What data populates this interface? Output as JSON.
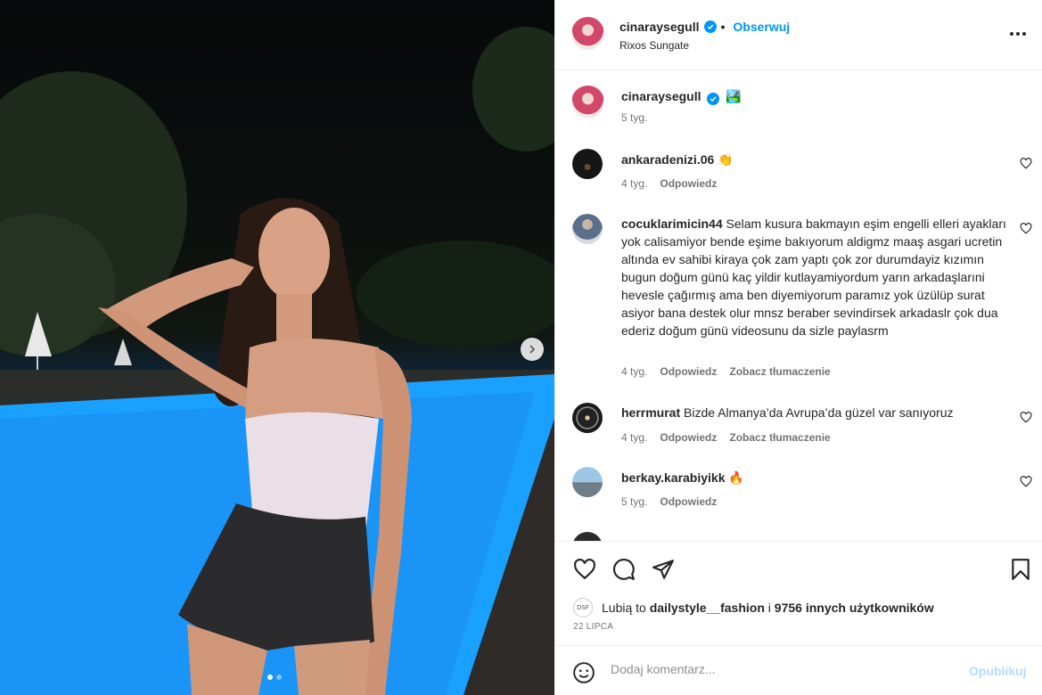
{
  "post": {
    "username": "cinaraysegull",
    "follow_label": "Obserwuj",
    "location": "Rixos Sungate",
    "caption_emoji": "🏞️",
    "caption_time": "5 tyg."
  },
  "comments": [
    {
      "username": "ankaradenizi.06",
      "text": "👏",
      "time": "4 tyg.",
      "reply": "Odpowiedz",
      "translate": ""
    },
    {
      "username": "cocuklarimicin44",
      "text": "Selam kusura bakmayın eşim engelli elleri ayakları yok calisamiyor bende eşime bakıyorum aldigmz maaş asgari ucretin altında ev sahibi kiraya çok zam yaptı çok zor durumdayiz kızımın bugun doğum günü kaç yildir kutlayamiyordum yarın arkadaşlarıni hevesle çağırmış ama ben diyemiyorum paramız yok üzülüp surat asiyor bana destek olur mnsz beraber sevindirsek arkadaslr çok dua ederiz doğum günü videosunu da sizle paylasrm",
      "time": "4 tyg.",
      "reply": "Odpowiedz",
      "translate": "Zobacz tłumaczenie"
    },
    {
      "username": "herrmurat",
      "text": "Bizde Almanya’da Avrupa’da güzel var sanıyoruz",
      "time": "4 tyg.",
      "reply": "Odpowiedz",
      "translate": "Zobacz tłumaczenie"
    },
    {
      "username": "berkay.karabiyikk",
      "text": "🔥",
      "time": "5 tyg.",
      "reply": "Odpowiedz",
      "translate": ""
    }
  ],
  "likes": {
    "prefix": "Lubią to",
    "user": "dailystyle__fashion",
    "connector": "i",
    "others": "9756 innych użytkowników",
    "badge": "DSF"
  },
  "date": "22 LIPCA",
  "add_comment": {
    "placeholder": "Dodaj komentarz...",
    "publish_label": "Opublikuj"
  },
  "colors": {
    "accent": "#0095f6",
    "publish_disabled": "#b3dbff",
    "pool": "#1590ff"
  }
}
